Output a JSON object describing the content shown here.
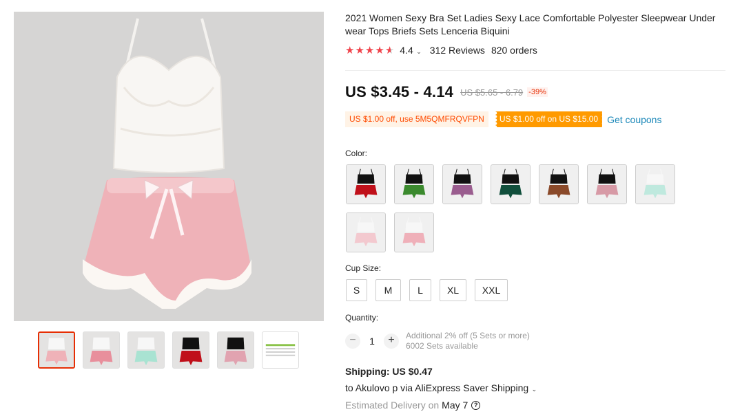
{
  "product": {
    "title": "2021 Women Sexy Bra Set Ladies Sexy Lace Comfortable Polyester Sleepwear Under wear Tops Briefs Sets Lenceria Biquini",
    "rating_value": "4.4",
    "rating_stars": 4.4,
    "reviews": "312 Reviews",
    "orders": "820 orders",
    "price": "US $3.45 - 4.14",
    "original_price": "US $5.65 - 6.79",
    "discount": "-39%",
    "coupon_code": "US $1.00 off, use 5M5QMFRQVFPN",
    "coupon_offer": "US $1.00 off on US $15.00",
    "get_coupons": "Get coupons",
    "color_label": "Color:",
    "colors": [
      {
        "name": "black-red",
        "top": "#111111",
        "bottom": "#c0101a"
      },
      {
        "name": "black-green",
        "top": "#111111",
        "bottom": "#3b8a2e"
      },
      {
        "name": "black-purple",
        "top": "#111111",
        "bottom": "#9a5d8f"
      },
      {
        "name": "black-teal",
        "top": "#111111",
        "bottom": "#114f3c"
      },
      {
        "name": "black-brown",
        "top": "#111111",
        "bottom": "#8a4a2a"
      },
      {
        "name": "black-pink",
        "top": "#111111",
        "bottom": "#d79aa6"
      },
      {
        "name": "white-mint",
        "top": "#f7f7f7",
        "bottom": "#bfe9de"
      },
      {
        "name": "white-pink-light",
        "top": "#f7f7f7",
        "bottom": "#f3c9cf"
      },
      {
        "name": "white-pink",
        "top": "#f7f7f7",
        "bottom": "#efb0b9"
      }
    ],
    "cup_size_label": "Cup Size:",
    "sizes": [
      "S",
      "M",
      "L",
      "XL",
      "XXL"
    ],
    "quantity_label": "Quantity:",
    "quantity": "1",
    "qty_minus": "−",
    "qty_plus": "+",
    "bulk_offer": "Additional 2% off (5 Sets or more)",
    "availability": "6002 Sets available",
    "shipping": "Shipping: US $0.47",
    "ship_via": "to Akulovo p via AliExpress Saver Shipping",
    "delivery_label": "Estimated Delivery on",
    "delivery_date": "May 7"
  },
  "gallery": {
    "main_top_color": "#f8f6f3",
    "main_bottom_color": "#efb2b8",
    "thumbs": [
      {
        "name": "thumb-white-pink",
        "top": "#f7f7f7",
        "bottom": "#efb2b8",
        "active": true
      },
      {
        "name": "thumb-white-pink-2",
        "top": "#f7f7f7",
        "bottom": "#e88f9c",
        "active": false
      },
      {
        "name": "thumb-white-mint",
        "top": "#f7f7f7",
        "bottom": "#a9e3d2",
        "active": false
      },
      {
        "name": "thumb-black-red",
        "top": "#111111",
        "bottom": "#c0101a",
        "active": false
      },
      {
        "name": "thumb-black-pink",
        "top": "#111111",
        "bottom": "#e1a3b0",
        "active": false
      },
      {
        "name": "thumb-size-chart",
        "top": "",
        "bottom": "",
        "active": false
      }
    ]
  }
}
